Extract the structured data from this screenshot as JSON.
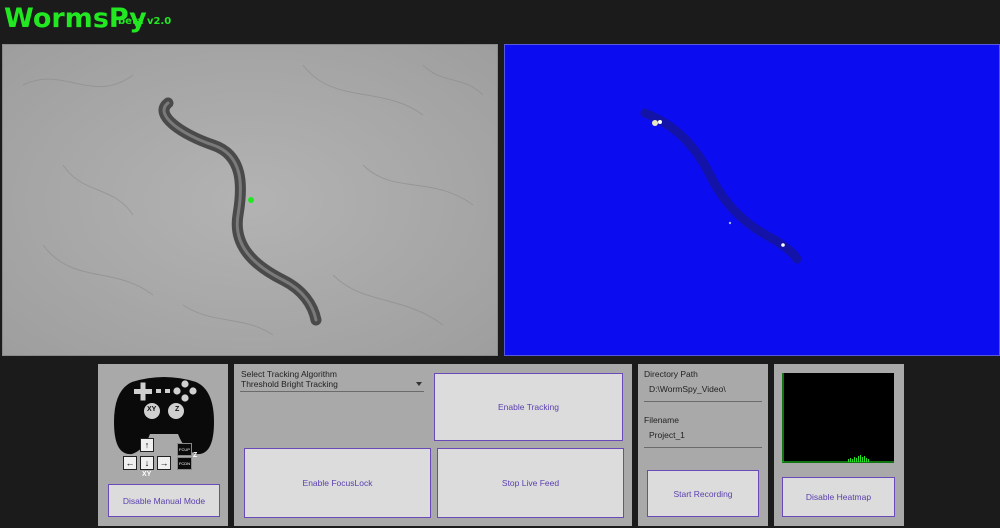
{
  "app": {
    "title": "WormsPy",
    "version": "beta v2.0"
  },
  "controller": {
    "xy_stick_label": "XY",
    "z_stick_label": "Z",
    "dpad_label": "XY",
    "fcup_label": "FCUP",
    "fcdn_label": "FCDN",
    "z_side_label": "Z",
    "up_arrow": "↑",
    "down_arrow": "↓",
    "left_arrow": "←",
    "right_arrow": "→",
    "manual_mode_button": "Disable Manual Mode"
  },
  "tracking": {
    "algorithm_label": "Select Tracking Algorithm",
    "algorithm_value": "Threshold Bright Tracking",
    "enable_tracking_button": "Enable Tracking",
    "focuslock_button": "Enable FocusLock",
    "live_feed_button": "Stop Live Feed"
  },
  "recording": {
    "directory_label": "Directory Path",
    "directory_value": "D:\\WormSpy_Video\\",
    "filename_label": "Filename",
    "filename_value": "Project_1",
    "start_recording_button": "Start Recording"
  },
  "heatmap": {
    "disable_heatmap_button": "Disable Heatmap"
  },
  "colors": {
    "accent_green": "#22e822",
    "button_text": "#5a3fae",
    "fluorescence_blue": "#0c0cf0"
  }
}
